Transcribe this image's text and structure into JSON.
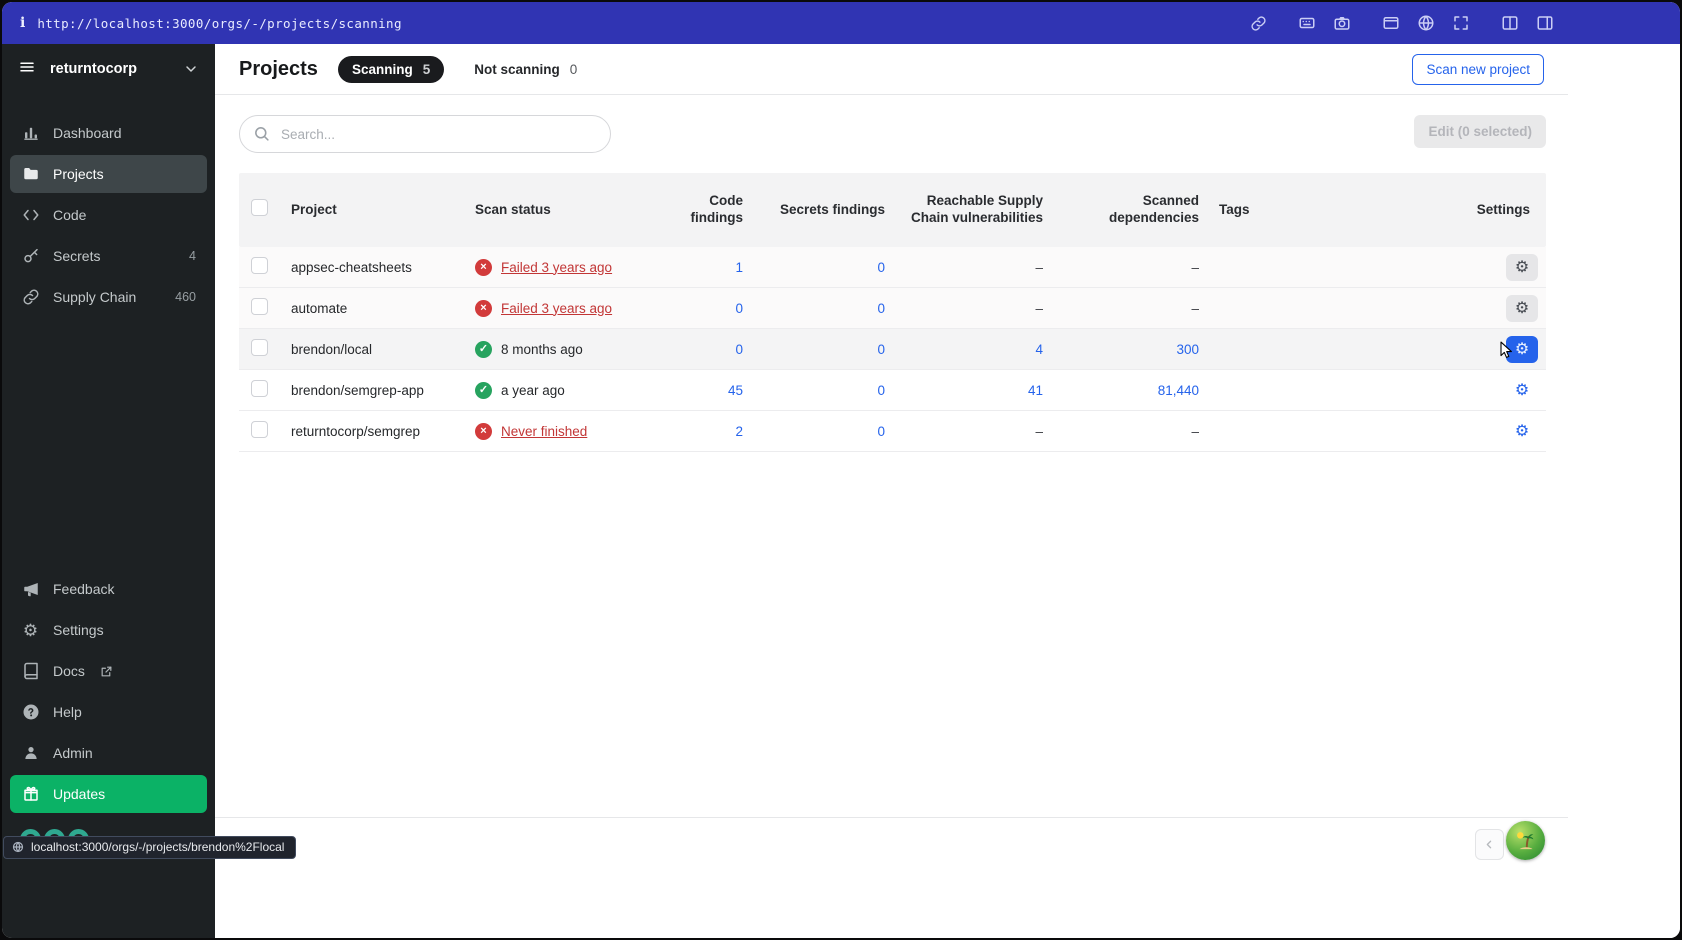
{
  "topbar": {
    "info_glyph": "i",
    "url": "http://localhost:3000/orgs/-/projects/scanning",
    "icons": [
      "link-icon",
      "keyboard-icon",
      "camera-icon",
      "terminal-icon",
      "globe-icon",
      "expand-icon",
      "columns-icon",
      "sidebar-panel-icon"
    ]
  },
  "sidebar": {
    "org_name": "returntocorp",
    "nav_top": [
      {
        "label": "Dashboard",
        "badge": ""
      },
      {
        "label": "Projects",
        "badge": ""
      },
      {
        "label": "Code",
        "badge": ""
      },
      {
        "label": "Secrets",
        "badge": "4"
      },
      {
        "label": "Supply Chain",
        "badge": "460"
      }
    ],
    "nav_bottom": [
      {
        "label": "Feedback"
      },
      {
        "label": "Settings"
      },
      {
        "label": "Docs"
      },
      {
        "label": "Help"
      },
      {
        "label": "Admin"
      },
      {
        "label": "Updates"
      }
    ]
  },
  "page": {
    "title": "Projects",
    "tabs": {
      "scanning_label": "Scanning",
      "scanning_count": "5",
      "not_scanning_label": "Not scanning",
      "not_scanning_count": "0"
    },
    "scan_new_button": "Scan new project",
    "search_placeholder": "Search...",
    "edit_button": "Edit (0 selected)"
  },
  "table": {
    "columns": [
      "Project",
      "Scan status",
      "Code findings",
      "Secrets findings",
      "Reachable Supply Chain vulnerabilities",
      "Scanned dependencies",
      "Tags",
      "Settings"
    ],
    "rows": [
      {
        "project": "appsec-cheatsheets",
        "status_text": "Failed 3 years ago",
        "status_type": "failed",
        "code_findings": "1",
        "secrets_findings": "0",
        "reachable_vulns": "–",
        "scanned_deps": "–",
        "tags": "",
        "settings_style": "gray",
        "hovered": false
      },
      {
        "project": "automate",
        "status_text": "Failed 3 years ago",
        "status_type": "failed",
        "code_findings": "0",
        "secrets_findings": "0",
        "reachable_vulns": "–",
        "scanned_deps": "–",
        "tags": "",
        "settings_style": "gray",
        "hovered": false
      },
      {
        "project": "brendon/local",
        "status_text": "8 months ago",
        "status_type": "success",
        "code_findings": "0",
        "secrets_findings": "0",
        "reachable_vulns": "4",
        "scanned_deps": "300",
        "tags": "",
        "settings_style": "blue-active",
        "hovered": true
      },
      {
        "project": "brendon/semgrep-app",
        "status_text": "a year ago",
        "status_type": "success",
        "code_findings": "45",
        "secrets_findings": "0",
        "reachable_vulns": "41",
        "scanned_deps": "81,440",
        "tags": "",
        "settings_style": "blue",
        "hovered": false
      },
      {
        "project": "returntocorp/semgrep",
        "status_text": "Never finished",
        "status_type": "failed",
        "code_findings": "2",
        "secrets_findings": "0",
        "reachable_vulns": "–",
        "scanned_deps": "–",
        "tags": "",
        "settings_style": "blue",
        "hovered": false
      }
    ]
  },
  "footer": {
    "prev_button": "‹"
  },
  "status_tooltip": {
    "text": "localhost:3000/orgs/-/projects/brendon%2Flocal"
  },
  "colors": {
    "topbar": "#3034b3",
    "sidebar_bg": "#1d2123",
    "accent_blue": "#2563eb",
    "updates_green": "#0bb266",
    "logo_teal": "#2fa890",
    "failed_red": "#c23636",
    "success_green": "#27a35f"
  }
}
